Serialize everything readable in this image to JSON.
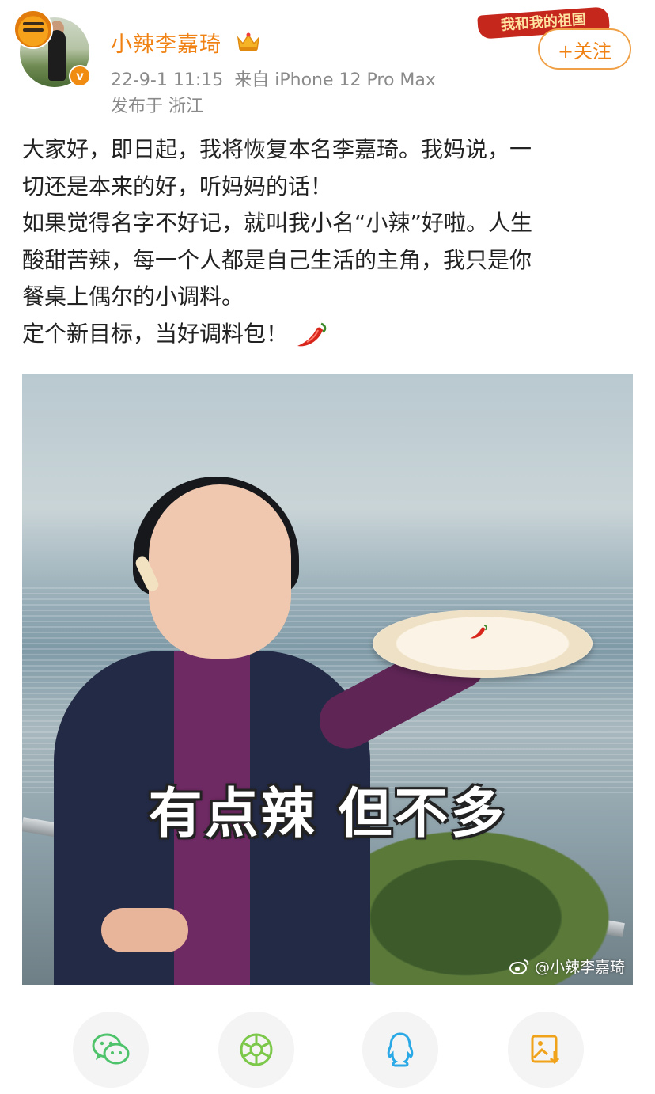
{
  "header": {
    "author_name": "小辣李嘉琦",
    "post_time": "22-9-1 11:15",
    "source": "来自 iPhone 12 Pro Max",
    "location": "发布于 浙江",
    "event_banner": "我和我的祖国",
    "follow_label": "+关注",
    "verified_mark": "v"
  },
  "post": {
    "lines": [
      "大家好，即日起，我将恢复本名李嘉琦。我妈说，一",
      "切还是本来的好，听妈妈的话！",
      "如果觉得名字不好记，就叫我小名“小辣”好啦。人生",
      "酸甜苦辣，每一个人都是自己生活的主角，我只是你",
      "餐桌上偶尔的小调料。",
      "定个新目标，当好调料包！"
    ],
    "emoji": "chili-pepper-icon"
  },
  "image": {
    "caption": "有点辣 但不多",
    "watermark": "@小辣李嘉琦"
  },
  "share": {
    "icons": [
      "wechat-icon",
      "moments-icon",
      "qq-icon",
      "save-image-icon"
    ]
  },
  "colors": {
    "accent": "#f08214",
    "text": "#222222",
    "meta": "#8a8a8a"
  }
}
